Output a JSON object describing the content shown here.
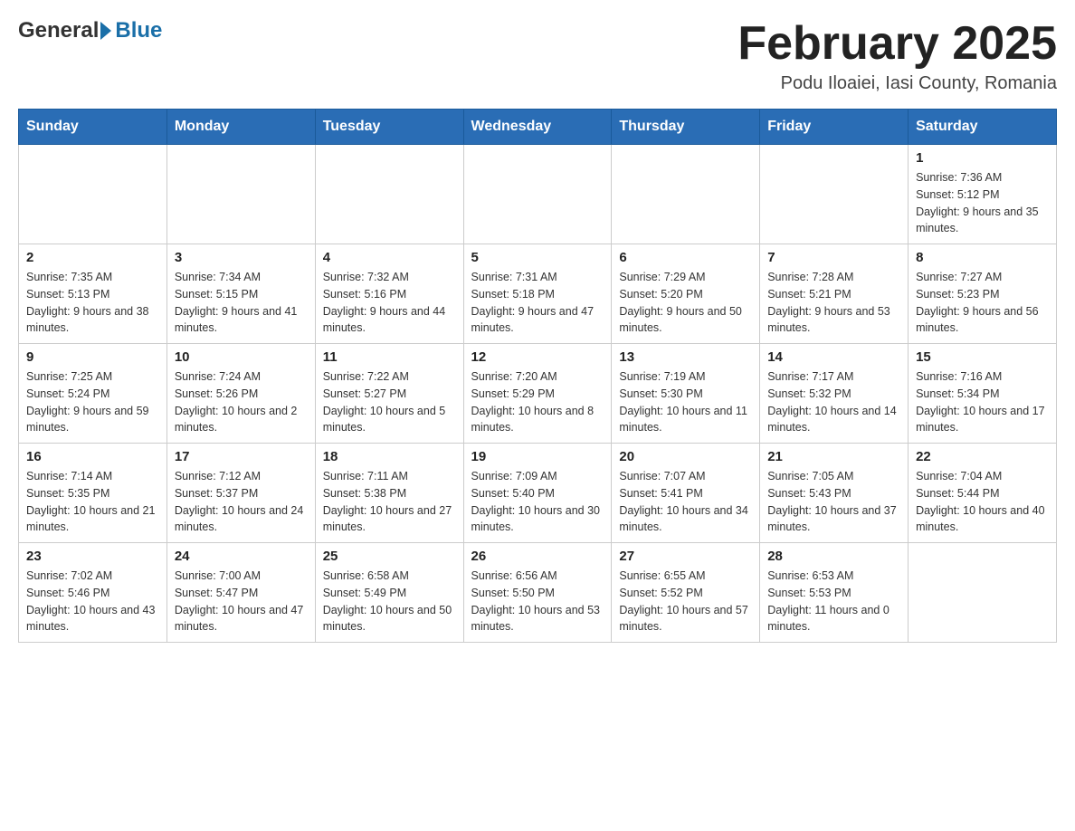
{
  "header": {
    "logo_general": "General",
    "logo_blue": "Blue",
    "month_title": "February 2025",
    "location": "Podu Iloaiei, Iasi County, Romania"
  },
  "weekdays": [
    "Sunday",
    "Monday",
    "Tuesday",
    "Wednesday",
    "Thursday",
    "Friday",
    "Saturday"
  ],
  "weeks": [
    [
      {
        "day": "",
        "info": ""
      },
      {
        "day": "",
        "info": ""
      },
      {
        "day": "",
        "info": ""
      },
      {
        "day": "",
        "info": ""
      },
      {
        "day": "",
        "info": ""
      },
      {
        "day": "",
        "info": ""
      },
      {
        "day": "1",
        "info": "Sunrise: 7:36 AM\nSunset: 5:12 PM\nDaylight: 9 hours and 35 minutes."
      }
    ],
    [
      {
        "day": "2",
        "info": "Sunrise: 7:35 AM\nSunset: 5:13 PM\nDaylight: 9 hours and 38 minutes."
      },
      {
        "day": "3",
        "info": "Sunrise: 7:34 AM\nSunset: 5:15 PM\nDaylight: 9 hours and 41 minutes."
      },
      {
        "day": "4",
        "info": "Sunrise: 7:32 AM\nSunset: 5:16 PM\nDaylight: 9 hours and 44 minutes."
      },
      {
        "day": "5",
        "info": "Sunrise: 7:31 AM\nSunset: 5:18 PM\nDaylight: 9 hours and 47 minutes."
      },
      {
        "day": "6",
        "info": "Sunrise: 7:29 AM\nSunset: 5:20 PM\nDaylight: 9 hours and 50 minutes."
      },
      {
        "day": "7",
        "info": "Sunrise: 7:28 AM\nSunset: 5:21 PM\nDaylight: 9 hours and 53 minutes."
      },
      {
        "day": "8",
        "info": "Sunrise: 7:27 AM\nSunset: 5:23 PM\nDaylight: 9 hours and 56 minutes."
      }
    ],
    [
      {
        "day": "9",
        "info": "Sunrise: 7:25 AM\nSunset: 5:24 PM\nDaylight: 9 hours and 59 minutes."
      },
      {
        "day": "10",
        "info": "Sunrise: 7:24 AM\nSunset: 5:26 PM\nDaylight: 10 hours and 2 minutes."
      },
      {
        "day": "11",
        "info": "Sunrise: 7:22 AM\nSunset: 5:27 PM\nDaylight: 10 hours and 5 minutes."
      },
      {
        "day": "12",
        "info": "Sunrise: 7:20 AM\nSunset: 5:29 PM\nDaylight: 10 hours and 8 minutes."
      },
      {
        "day": "13",
        "info": "Sunrise: 7:19 AM\nSunset: 5:30 PM\nDaylight: 10 hours and 11 minutes."
      },
      {
        "day": "14",
        "info": "Sunrise: 7:17 AM\nSunset: 5:32 PM\nDaylight: 10 hours and 14 minutes."
      },
      {
        "day": "15",
        "info": "Sunrise: 7:16 AM\nSunset: 5:34 PM\nDaylight: 10 hours and 17 minutes."
      }
    ],
    [
      {
        "day": "16",
        "info": "Sunrise: 7:14 AM\nSunset: 5:35 PM\nDaylight: 10 hours and 21 minutes."
      },
      {
        "day": "17",
        "info": "Sunrise: 7:12 AM\nSunset: 5:37 PM\nDaylight: 10 hours and 24 minutes."
      },
      {
        "day": "18",
        "info": "Sunrise: 7:11 AM\nSunset: 5:38 PM\nDaylight: 10 hours and 27 minutes."
      },
      {
        "day": "19",
        "info": "Sunrise: 7:09 AM\nSunset: 5:40 PM\nDaylight: 10 hours and 30 minutes."
      },
      {
        "day": "20",
        "info": "Sunrise: 7:07 AM\nSunset: 5:41 PM\nDaylight: 10 hours and 34 minutes."
      },
      {
        "day": "21",
        "info": "Sunrise: 7:05 AM\nSunset: 5:43 PM\nDaylight: 10 hours and 37 minutes."
      },
      {
        "day": "22",
        "info": "Sunrise: 7:04 AM\nSunset: 5:44 PM\nDaylight: 10 hours and 40 minutes."
      }
    ],
    [
      {
        "day": "23",
        "info": "Sunrise: 7:02 AM\nSunset: 5:46 PM\nDaylight: 10 hours and 43 minutes."
      },
      {
        "day": "24",
        "info": "Sunrise: 7:00 AM\nSunset: 5:47 PM\nDaylight: 10 hours and 47 minutes."
      },
      {
        "day": "25",
        "info": "Sunrise: 6:58 AM\nSunset: 5:49 PM\nDaylight: 10 hours and 50 minutes."
      },
      {
        "day": "26",
        "info": "Sunrise: 6:56 AM\nSunset: 5:50 PM\nDaylight: 10 hours and 53 minutes."
      },
      {
        "day": "27",
        "info": "Sunrise: 6:55 AM\nSunset: 5:52 PM\nDaylight: 10 hours and 57 minutes."
      },
      {
        "day": "28",
        "info": "Sunrise: 6:53 AM\nSunset: 5:53 PM\nDaylight: 11 hours and 0 minutes."
      },
      {
        "day": "",
        "info": ""
      }
    ]
  ]
}
